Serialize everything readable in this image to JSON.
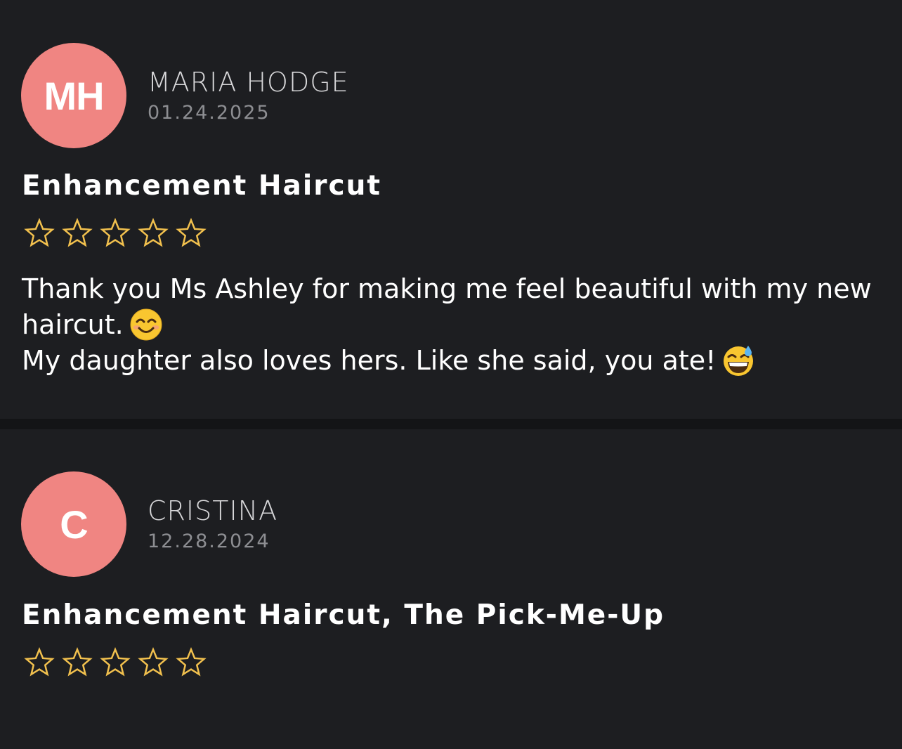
{
  "colors": {
    "background": "#1d1e21",
    "divider": "#131416",
    "avatar_bg": "#f08582",
    "star_outline": "#f2c14e",
    "name_text": "#d7d7d9",
    "date_text": "#8d8e92"
  },
  "reviews": [
    {
      "avatar_initials": "MH",
      "reviewer_name": "MARIA HODGE",
      "date": "01.24.2025",
      "service": "Enhancement Haircut",
      "rating_icons": [
        "star-outline-icon",
        "star-outline-icon",
        "star-outline-icon",
        "star-outline-icon",
        "star-outline-icon"
      ],
      "text_lines": [
        "Thank you Ms Ashley for making me feel beautiful with my new",
        "haircut.",
        "My daughter also loves hers. Like she said, you ate!"
      ],
      "emojis": [
        "smiling-face-icon",
        "grinning-sweat-face-icon"
      ]
    },
    {
      "avatar_initials": "C",
      "reviewer_name": "CRISTINA",
      "date": "12.28.2024",
      "service": "Enhancement Haircut, The Pick-Me-Up",
      "rating_icons": [
        "star-outline-icon",
        "star-outline-icon",
        "star-outline-icon",
        "star-outline-icon",
        "star-outline-icon"
      ]
    }
  ]
}
